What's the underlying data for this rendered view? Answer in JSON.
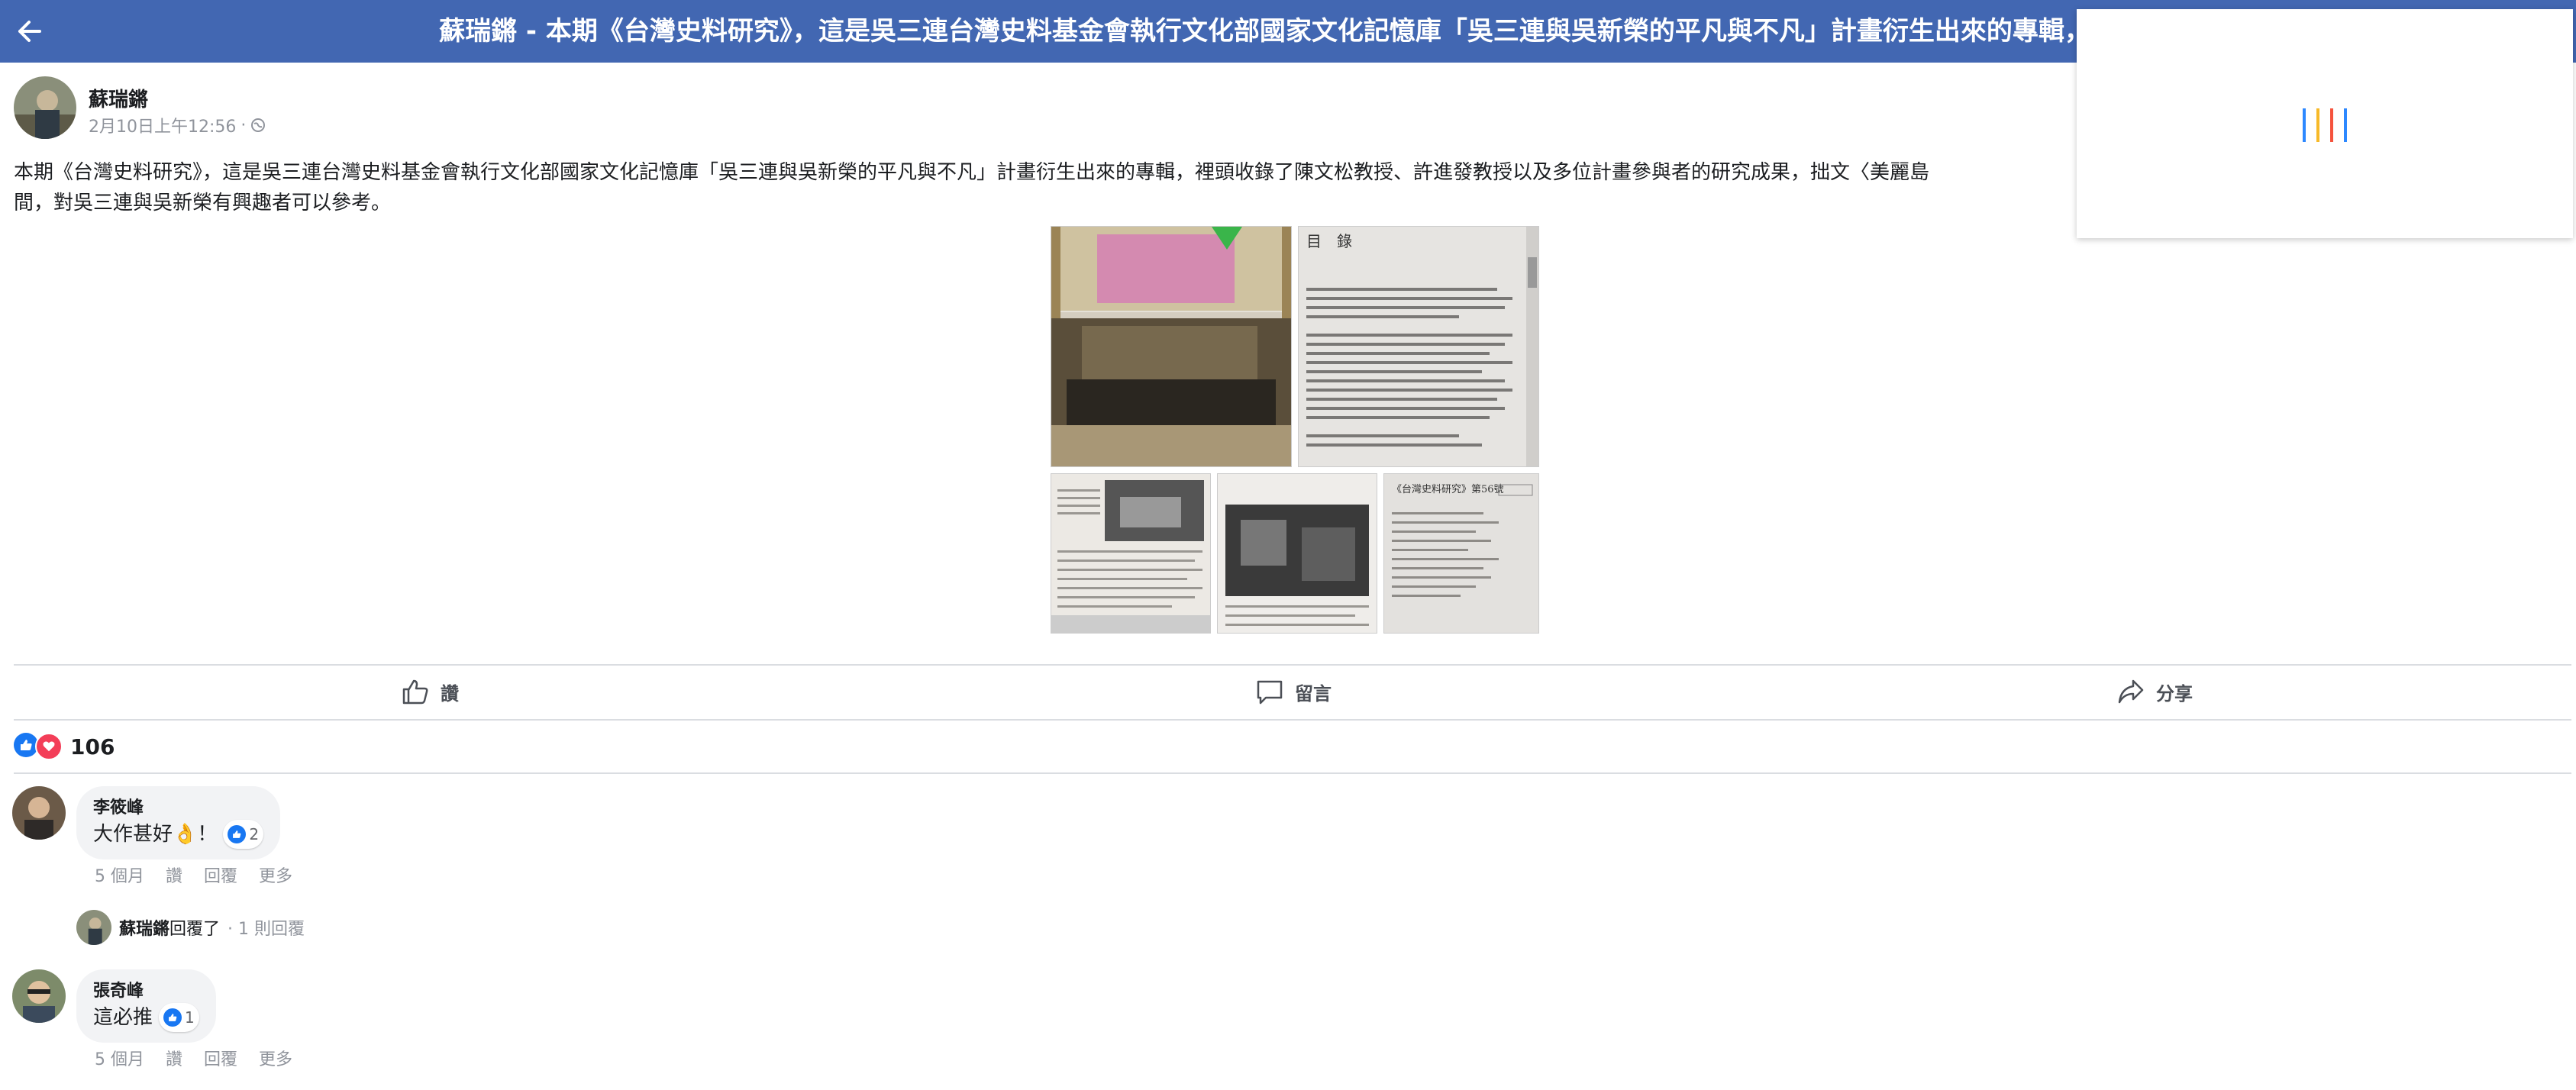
{
  "header": {
    "title": "蘇瑞鏘 - 本期《台灣史料研究》，這是吳三連台灣史料基金會執行文化部國家文化記憶庫「吳三連與吳新榮的平凡與不凡」計畫衍生出來的專輯，裡... | Fa"
  },
  "post": {
    "author": "蘇瑞鏘",
    "time": "2月10日上午12:56",
    "separator": "·",
    "text": "本期《台灣史料研究》，這是吳三連台灣史料基金會執行文化部國家文化記憶庫「吳三連與吳新榮的平凡與不凡」計畫衍生出來的專輯，裡頭收錄了陳文松教授、許進發教授以及多位計畫參與者的研究成果，拙文〈美麗島\n間，對吳三連與吳新榮有興趣者可以參考。",
    "photo_toc_heading": "目　錄",
    "photo_journal_heading": "《台灣史料研究》第56號"
  },
  "actions": {
    "like": "讚",
    "comment": "留言",
    "share": "分享"
  },
  "reactions": {
    "count": "106"
  },
  "comments": [
    {
      "name": "李筱峰",
      "text": "大作甚好👌！",
      "likes": "2",
      "time": "5 個月",
      "like_label": "讚",
      "reply_label": "回覆",
      "more_label": "更多"
    },
    {
      "name": "張奇峰",
      "text": "這必推",
      "likes": "1",
      "time": "5 個月",
      "like_label": "讚",
      "reply_label": "回覆",
      "more_label": "更多"
    }
  ],
  "reply_summary": {
    "name": "蘇瑞鏘",
    "action": "回覆了",
    "count": "· 1 則回覆"
  },
  "colors": {
    "topbar": "#4267b2",
    "like_blue": "#1877f2",
    "love_red": "#f33e58",
    "loader": [
      "#2d88ff",
      "#f7b928",
      "#f5533d",
      "#2d88ff"
    ]
  }
}
